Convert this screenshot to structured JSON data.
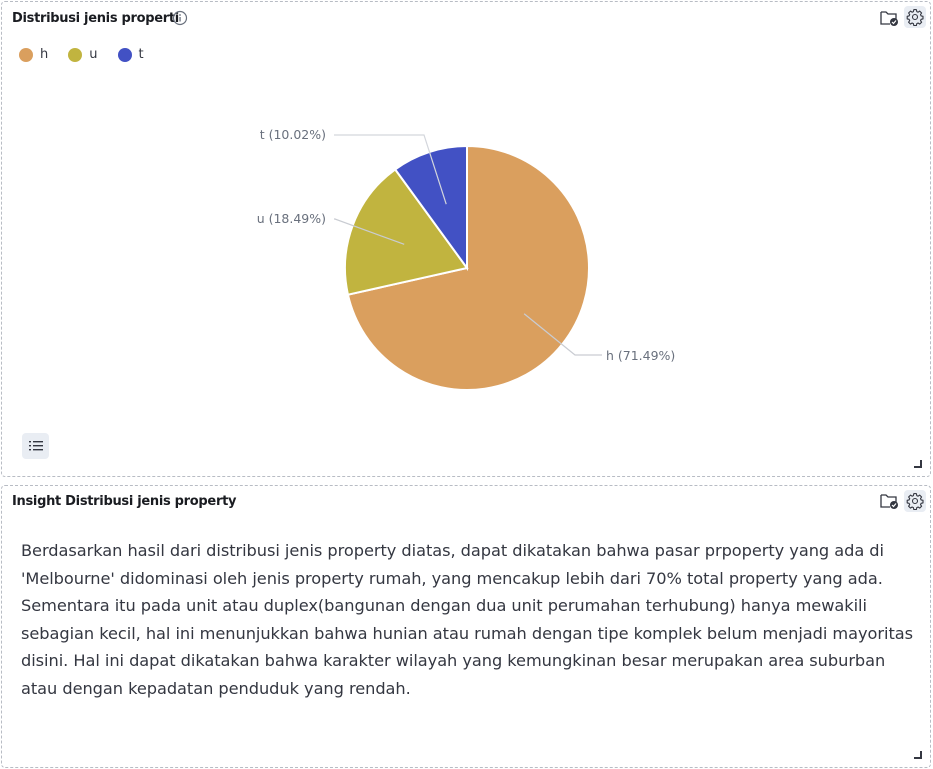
{
  "panel1": {
    "title": "Distribusi jenis properti",
    "header_icons": [
      "folder-check-icon",
      "gear-icon"
    ],
    "table_toggle_icon": "list-icon"
  },
  "chart_data": {
    "type": "pie",
    "title": "Distribusi jenis properti",
    "legend_position": "top-left",
    "categories": [
      "h",
      "u",
      "t"
    ],
    "values": [
      71.49,
      18.49,
      10.02
    ],
    "slice_labels": [
      "h (71.49%)",
      "u (18.49%)",
      "t (10.02%)"
    ],
    "colors": [
      "#da9f5e",
      "#c1b43f",
      "#4251c4"
    ]
  },
  "panel2": {
    "title": "Insight Distribusi jenis property",
    "header_icons": [
      "folder-check-icon",
      "gear-icon"
    ],
    "body_text": "Berdasarkan hasil dari distribusi jenis property diatas, dapat dikatakan bahwa pasar prpoperty yang ada di 'Melbourne' didominasi oleh jenis property rumah, yang mencakup lebih dari 70% total property yang ada. Sementara itu pada unit atau duplex(bangunan dengan dua unit perumahan terhubung) hanya mewakili sebagian kecil, hal ini menunjukkan bahwa hunian atau rumah dengan tipe komplek belum menjadi mayoritas disini. Hal ini dapat dikatakan bahwa karakter wilayah yang kemungkinan besar merupakan area suburban atau dengan kepadatan penduduk yang rendah."
  }
}
